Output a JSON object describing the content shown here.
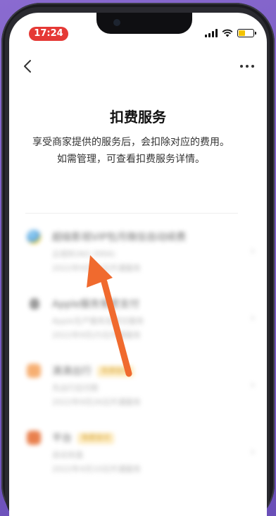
{
  "status_bar": {
    "time": "17:24",
    "signal_bars": 4,
    "battery_level": 0.45
  },
  "nav": {
    "back_icon": "chevron-left-icon",
    "more_icon": "more-dots-icon"
  },
  "page": {
    "title": "扣费服务",
    "description": "享受商家提供的服务后，会扣除对应的费用。如需管理，可查看扣费服务详情。"
  },
  "services": [
    {
      "title": "超级影视VIP包月微信自动续费",
      "line1": "云视听(NO.3994)",
      "line2": "2022年9月25日开通服务",
      "badge": "",
      "icon_color": "#5aa7e6"
    },
    {
      "title": "Apple服务免密支付",
      "line1": "Apple生产服务及提交服务",
      "line2": "2022年9月25日开通服务",
      "badge": "",
      "icon_color": "#777777"
    },
    {
      "title": "滴滴出行",
      "line1": "先出行后付款",
      "line2": "2022年9月26日开通服务",
      "badge": "先享后付",
      "icon_color": "#f5a15a"
    },
    {
      "title": "平台",
      "line1": "自动充值",
      "line2": "2022年4月10日开通服务",
      "badge": "免密支付",
      "icon_color": "#e56a2e"
    }
  ],
  "colors": {
    "time_pill": "#e53935",
    "arrow": "#f06a2e",
    "background": "#7a5cc4"
  }
}
